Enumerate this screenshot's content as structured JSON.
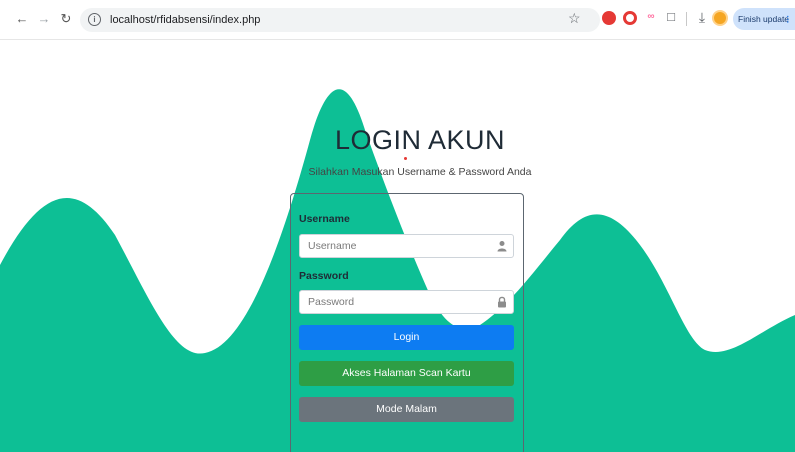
{
  "browser": {
    "url": "localhost/rfidabsensi/index.php",
    "finish_update_label": "Finish update",
    "menu_glyph": "⋮",
    "icons": [
      "back-arrow-icon",
      "forward-arrow-icon",
      "reload-icon",
      "site-info-icon",
      "bookmark-star-icon",
      "adblock-extension-icon",
      "opera-extension-icon",
      "infinity-extension-icon",
      "extensions-puzzle-icon",
      "download-icon",
      "profile-avatar-icon",
      "more-menu-icon"
    ]
  },
  "login": {
    "title": "LOGIN AKUN",
    "subtitle": "Silahkan Masukan Username & Password Anda",
    "username_label": "Username",
    "username_placeholder": "Username",
    "password_label": "Password",
    "password_placeholder": "Password",
    "login_button": "Login",
    "scan_button": "Akses Halaman Scan Kartu",
    "night_button": "Mode Malam"
  },
  "colors": {
    "wave": "#0dbf95",
    "login": "#0d7cf2",
    "scan": "#2e9e45",
    "night": "#6b747c"
  }
}
